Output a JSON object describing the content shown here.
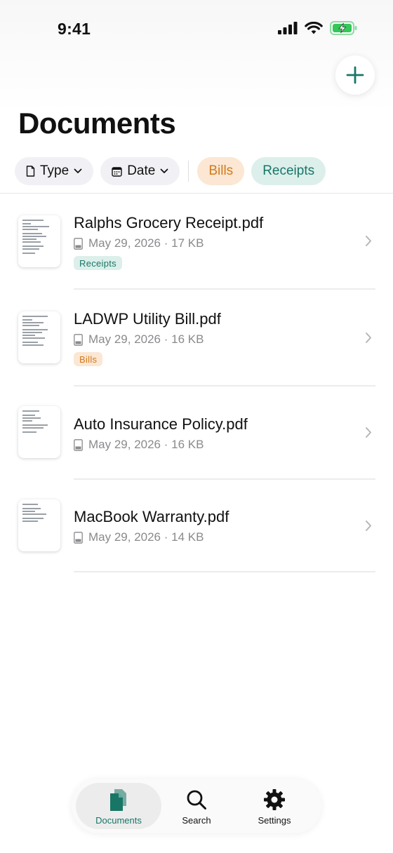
{
  "status_bar": {
    "time": "9:41"
  },
  "header": {
    "title": "Documents"
  },
  "filters": {
    "type_label": "Type",
    "date_label": "Date",
    "tags": [
      "Bills",
      "Receipts"
    ]
  },
  "documents": [
    {
      "name": "Ralphs Grocery Receipt.pdf",
      "meta": "May 29, 2026 · 17 KB",
      "tag": "Receipts"
    },
    {
      "name": "LADWP Utility Bill.pdf",
      "meta": "May 29, 2026 · 16 KB",
      "tag": "Bills"
    },
    {
      "name": "Auto Insurance Policy.pdf",
      "meta": "May 29, 2026 · 16 KB",
      "tag": ""
    },
    {
      "name": "MacBook Warranty.pdf",
      "meta": "May 29, 2026 · 14 KB",
      "tag": ""
    }
  ],
  "tab_bar": {
    "documents_label": "Documents",
    "search_label": "Search",
    "settings_label": "Settings",
    "active": "documents"
  },
  "colors": {
    "accent": "#187666",
    "bills": "#d27a1e",
    "receipts_bg": "#dcefeb",
    "bills_bg": "#fbe7d3"
  }
}
